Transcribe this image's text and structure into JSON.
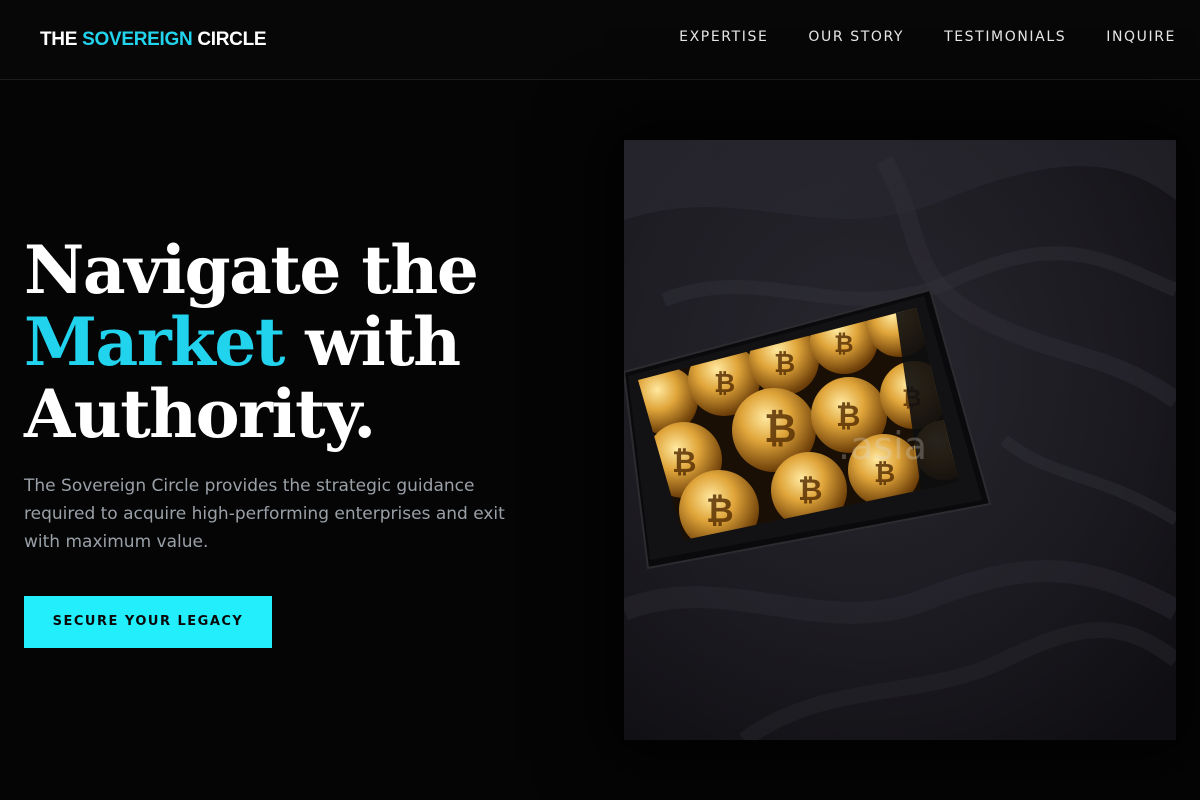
{
  "header": {
    "logo": {
      "part1": "THE ",
      "accent": "SOVEREIGN",
      "part2": " CIRCLE"
    },
    "nav": [
      "EXPERTISE",
      "OUR STORY",
      "TESTIMONIALS",
      "INQUIRE"
    ]
  },
  "hero": {
    "title": {
      "line1": "Navigate the",
      "accent": "Market",
      "line2_rest": " with",
      "line3": "Authority."
    },
    "description": "The Sovereign Circle provides the strategic guidance required to acquire high-performing enterprises and exit with maximum value.",
    "cta_label": "SECURE YOUR LEGACY",
    "image": {
      "subject": "smartphone showing gold bitcoin coins on dark bed sheets",
      "watermark": ".asia"
    }
  },
  "colors": {
    "background": "#050505",
    "accent": "#22d3ee",
    "cta": "#22eefc",
    "muted_text": "#9aa0a8"
  }
}
